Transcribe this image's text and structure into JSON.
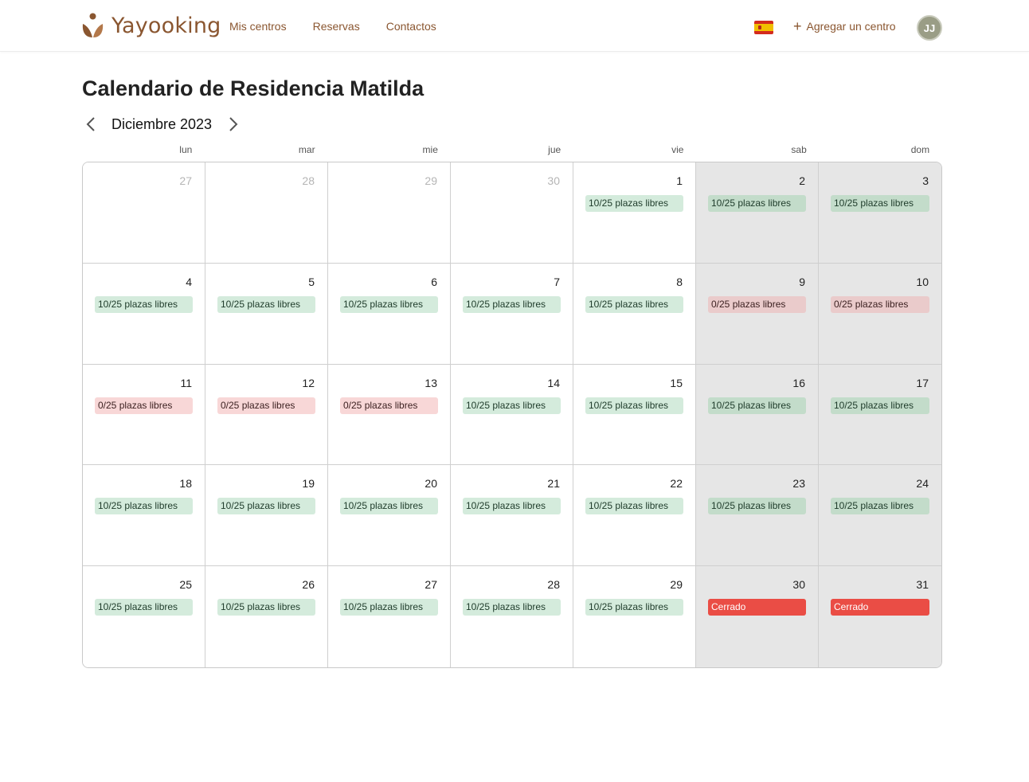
{
  "header": {
    "brand": "Yayooking",
    "nav": [
      "Mis centros",
      "Reservas",
      "Contactos"
    ],
    "add_center_label": "Agregar un centro",
    "avatar_initials": "JJ"
  },
  "page": {
    "title": "Calendario de Residencia Matilda",
    "month_label": "Diciembre 2023"
  },
  "weekdays": [
    "lun",
    "mar",
    "mie",
    "jue",
    "vie",
    "sab",
    "dom"
  ],
  "status_labels": {
    "ok": "10/25 plazas libres",
    "full": "0/25 plazas libres",
    "closed": "Cerrado"
  },
  "colors": {
    "brand": "#8a5630",
    "available": "#d4ebdc",
    "full": "#f8d7d7",
    "closed": "#ea4d45",
    "weekend": "#e6e6e6"
  },
  "days": [
    {
      "num": "27",
      "outside": true,
      "status": ""
    },
    {
      "num": "28",
      "outside": true,
      "status": ""
    },
    {
      "num": "29",
      "outside": true,
      "status": ""
    },
    {
      "num": "30",
      "outside": true,
      "status": ""
    },
    {
      "num": "1",
      "status": "ok"
    },
    {
      "num": "2",
      "status": "ok"
    },
    {
      "num": "3",
      "status": "ok"
    },
    {
      "num": "4",
      "status": "ok"
    },
    {
      "num": "5",
      "status": "ok"
    },
    {
      "num": "6",
      "status": "ok"
    },
    {
      "num": "7",
      "status": "ok"
    },
    {
      "num": "8",
      "status": "ok"
    },
    {
      "num": "9",
      "status": "full"
    },
    {
      "num": "10",
      "status": "full"
    },
    {
      "num": "11",
      "status": "full"
    },
    {
      "num": "12",
      "status": "full"
    },
    {
      "num": "13",
      "status": "full"
    },
    {
      "num": "14",
      "status": "ok"
    },
    {
      "num": "15",
      "status": "ok"
    },
    {
      "num": "16",
      "status": "ok"
    },
    {
      "num": "17",
      "status": "ok"
    },
    {
      "num": "18",
      "status": "ok"
    },
    {
      "num": "19",
      "status": "ok"
    },
    {
      "num": "20",
      "status": "ok"
    },
    {
      "num": "21",
      "status": "ok"
    },
    {
      "num": "22",
      "status": "ok"
    },
    {
      "num": "23",
      "status": "ok"
    },
    {
      "num": "24",
      "status": "ok"
    },
    {
      "num": "25",
      "status": "ok"
    },
    {
      "num": "26",
      "status": "ok"
    },
    {
      "num": "27",
      "status": "ok"
    },
    {
      "num": "28",
      "status": "ok"
    },
    {
      "num": "29",
      "status": "ok"
    },
    {
      "num": "30",
      "status": "closed"
    },
    {
      "num": "31",
      "status": "closed"
    }
  ]
}
